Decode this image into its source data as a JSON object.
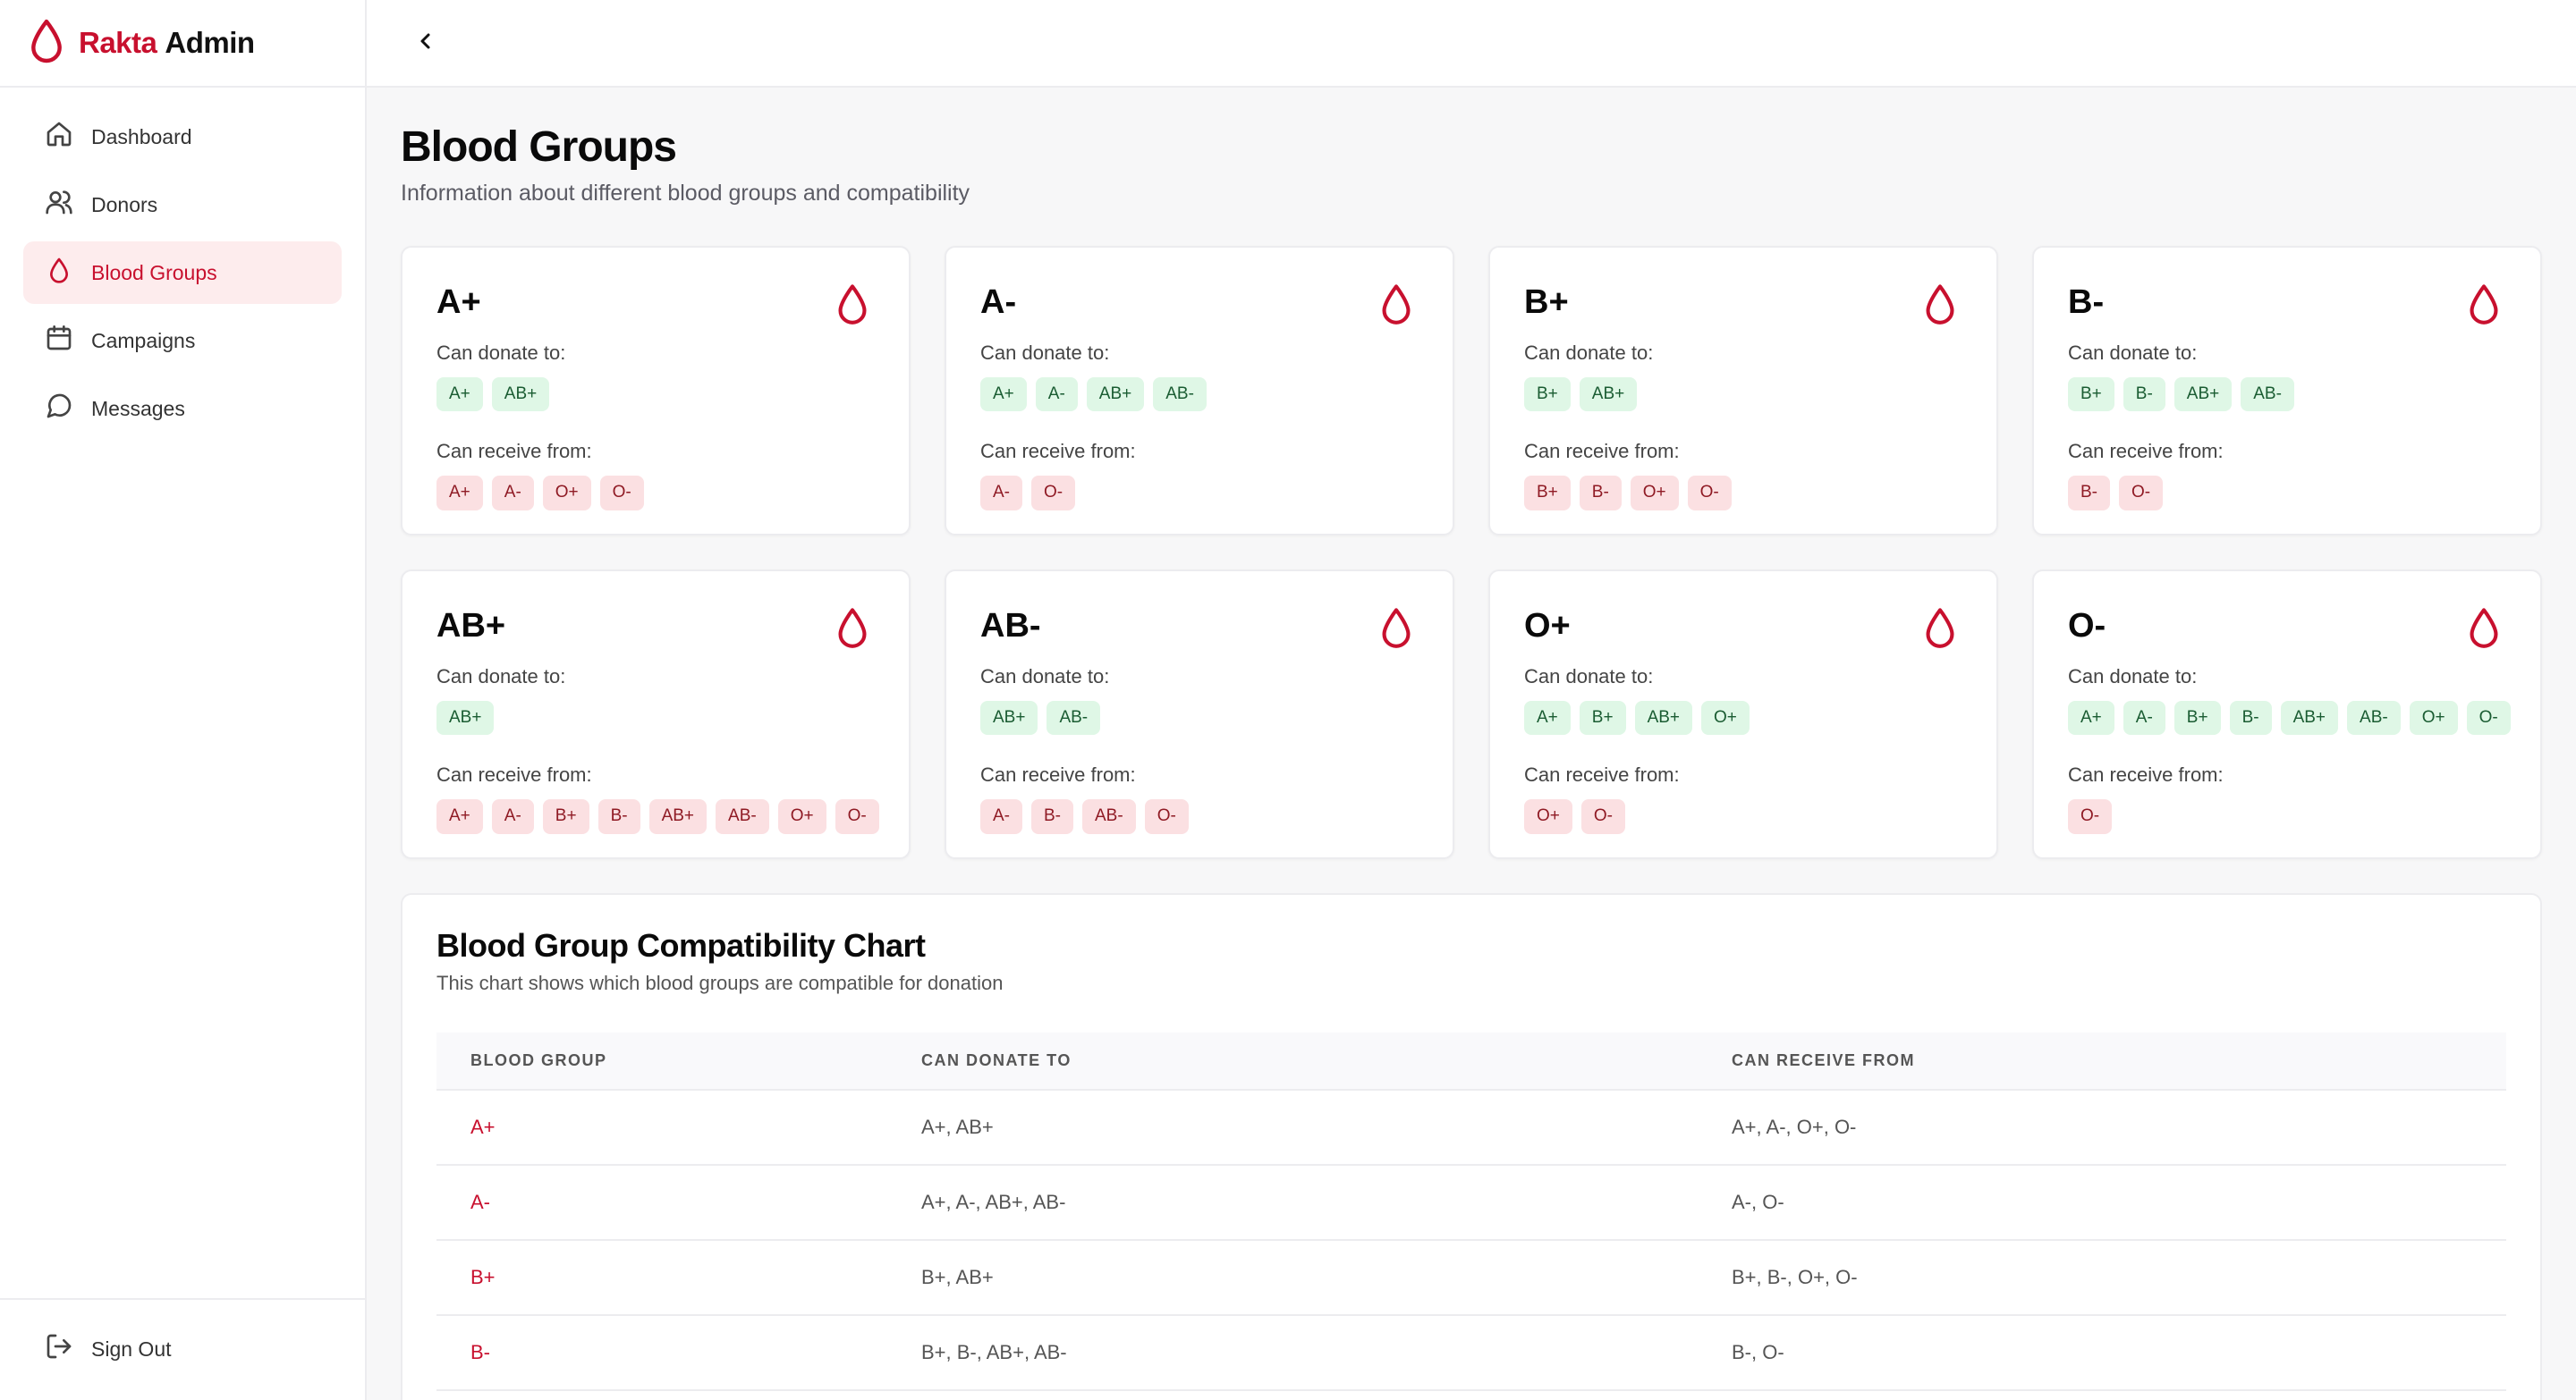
{
  "brand": {
    "name_accent": "Rakta",
    "name_rest": "Admin",
    "icon": "blood-drop-icon",
    "accent_color": "#c8102e"
  },
  "sidebar": {
    "items": [
      {
        "label": "Dashboard",
        "icon": "home-icon"
      },
      {
        "label": "Donors",
        "icon": "users-icon"
      },
      {
        "label": "Blood Groups",
        "icon": "blood-drop-icon",
        "active": true
      },
      {
        "label": "Campaigns",
        "icon": "calendar-icon"
      },
      {
        "label": "Messages",
        "icon": "message-icon"
      }
    ],
    "signout": {
      "label": "Sign Out",
      "icon": "logout-icon"
    }
  },
  "topbar": {
    "back_icon": "chevron-left-icon"
  },
  "page": {
    "title": "Blood Groups",
    "subtitle": "Information about different blood groups and compatibility"
  },
  "labels": {
    "donate": "Can donate to:",
    "receive": "Can receive from:"
  },
  "groups": [
    {
      "name": "A+",
      "donate": [
        "A+",
        "AB+"
      ],
      "receive": [
        "A+",
        "A-",
        "O+",
        "O-"
      ]
    },
    {
      "name": "A-",
      "donate": [
        "A+",
        "A-",
        "AB+",
        "AB-"
      ],
      "receive": [
        "A-",
        "O-"
      ]
    },
    {
      "name": "B+",
      "donate": [
        "B+",
        "AB+"
      ],
      "receive": [
        "B+",
        "B-",
        "O+",
        "O-"
      ]
    },
    {
      "name": "B-",
      "donate": [
        "B+",
        "B-",
        "AB+",
        "AB-"
      ],
      "receive": [
        "B-",
        "O-"
      ]
    },
    {
      "name": "AB+",
      "donate": [
        "AB+"
      ],
      "receive": [
        "A+",
        "A-",
        "B+",
        "B-",
        "AB+",
        "AB-",
        "O+",
        "O-"
      ]
    },
    {
      "name": "AB-",
      "donate": [
        "AB+",
        "AB-"
      ],
      "receive": [
        "A-",
        "B-",
        "AB-",
        "O-"
      ]
    },
    {
      "name": "O+",
      "donate": [
        "A+",
        "B+",
        "AB+",
        "O+"
      ],
      "receive": [
        "O+",
        "O-"
      ]
    },
    {
      "name": "O-",
      "donate": [
        "A+",
        "A-",
        "B+",
        "B-",
        "AB+",
        "AB-",
        "O+",
        "O-"
      ],
      "receive": [
        "O-"
      ]
    }
  ],
  "chart": {
    "title": "Blood Group Compatibility Chart",
    "subtitle": "This chart shows which blood groups are compatible for donation",
    "headers": [
      "BLOOD GROUP",
      "CAN DONATE TO",
      "CAN RECEIVE FROM"
    ],
    "rows": [
      [
        "A+",
        "A+, AB+",
        "A+, A-, O+, O-"
      ],
      [
        "A-",
        "A+, A-, AB+, AB-",
        "A-, O-"
      ],
      [
        "B+",
        "B+, AB+",
        "B+, B-, O+, O-"
      ],
      [
        "B-",
        "B+, B-, AB+, AB-",
        "B-, O-"
      ]
    ]
  }
}
